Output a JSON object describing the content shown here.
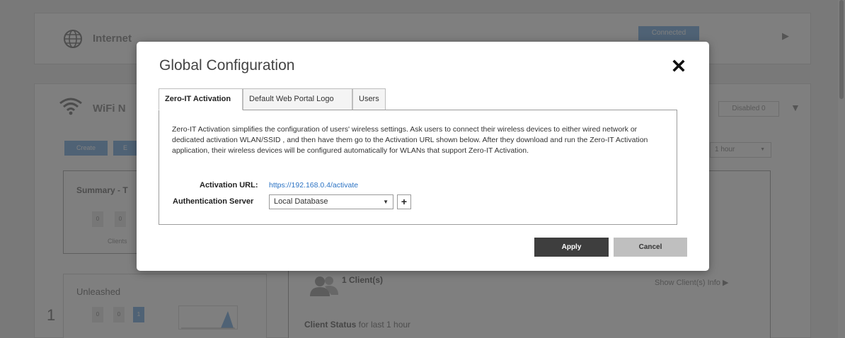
{
  "background": {
    "internet": {
      "label": "Internet",
      "status": "Connected"
    },
    "wifi": {
      "label": "WiFi N",
      "disabled_badge": "Disabled 0"
    },
    "toolbar": {
      "create_label": "Create",
      "edit_label": "E",
      "time_select": "1 hour"
    },
    "summary": {
      "title": "Summary - T",
      "tiles": [
        "0",
        "0"
      ],
      "caption": "Clients"
    },
    "unleashed": {
      "label": "Unleashed",
      "count": "1",
      "tiles": [
        "0",
        "0",
        "1"
      ]
    },
    "clients": {
      "count_label": "1 Client(s)",
      "show_info": "Show Client(s) Info ▶"
    },
    "client_status": {
      "bold": "Client Status",
      "rest": " for last 1 hour"
    },
    "arrows": {
      "internet": "▶",
      "wifi": "▼"
    }
  },
  "modal": {
    "title": "Global Configuration",
    "close_glyph": "✖",
    "tabs": [
      "Zero-IT Activation",
      "Default Web Portal Logo",
      "Users"
    ],
    "description": "Zero-IT Activation simplifies the configuration of users' wireless settings. Ask users to connect their wireless devices to either wired network or dedicated activation WLAN/SSID , and then have them go to the Activation URL shown below. After they download and run the Zero-IT Activation application, their wireless devices will be configured automatically for WLANs that support Zero-IT Activation.",
    "activation_url_label": "Activation URL:",
    "activation_url": "https://192.168.0.4/activate",
    "auth_server_label": "Authentication Server",
    "auth_server_value": "Local Database",
    "auth_server_arrow": "▼",
    "add_glyph": "+",
    "apply_label": "Apply",
    "cancel_label": "Cancel"
  },
  "colors": {
    "overlay": "rgba(0,0,0,0.5)",
    "apply": "#3e3e3e",
    "cancel": "#bfbfbf",
    "link": "#2a72c3"
  }
}
